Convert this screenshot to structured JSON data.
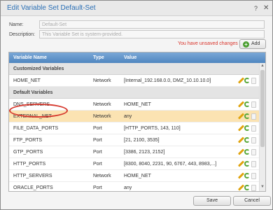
{
  "dialog": {
    "title": "Edit Variable Set Default-Set",
    "help": "?",
    "close": "✕"
  },
  "form": {
    "name_label": "Name:",
    "name_value": "Default-Set",
    "description_label": "Description:",
    "description_value": "This Variable Set is system-provided."
  },
  "status": {
    "unsaved": "You have unsaved changes"
  },
  "toolbar": {
    "add_label": "Add",
    "add_icon": "plus-icon"
  },
  "table": {
    "columns": [
      "Variable Name",
      "Type",
      "Value"
    ],
    "groups": {
      "customized": "Customized Variables",
      "default": "Default Variables"
    },
    "rows": [
      {
        "name": "HOME_NET",
        "type": "Network",
        "value": "[Internal_192.168.0.0, DMZ_10.10.10.0]"
      },
      {
        "name": "DNS_SERVERS",
        "type": "Network",
        "value": "HOME_NET"
      },
      {
        "name": "EXTERNAL_NET",
        "type": "Network",
        "value": "any"
      },
      {
        "name": "FILE_DATA_PORTS",
        "type": "Port",
        "value": "[HTTP_PORTS, 143, 110]"
      },
      {
        "name": "FTP_PORTS",
        "type": "Port",
        "value": "[21, 2100, 3535]"
      },
      {
        "name": "GTP_PORTS",
        "type": "Port",
        "value": "[3386, 2123, 2152]"
      },
      {
        "name": "HTTP_PORTS",
        "type": "Port",
        "value": "[8300, 8040, 2231, 90, 6767, 443, 8983,...]"
      },
      {
        "name": "HTTP_SERVERS",
        "type": "Network",
        "value": "HOME_NET"
      },
      {
        "name": "ORACLE_PORTS",
        "type": "Port",
        "value": "any"
      }
    ]
  },
  "footer": {
    "save_label": "Save",
    "cancel_label": "Cancel"
  },
  "colors": {
    "title": "#2a6fb5",
    "header": "#4f86c0",
    "selected_row": "#fbe3b2",
    "unsaved": "#d9342b",
    "highlight_ring": "#d63a2f"
  }
}
